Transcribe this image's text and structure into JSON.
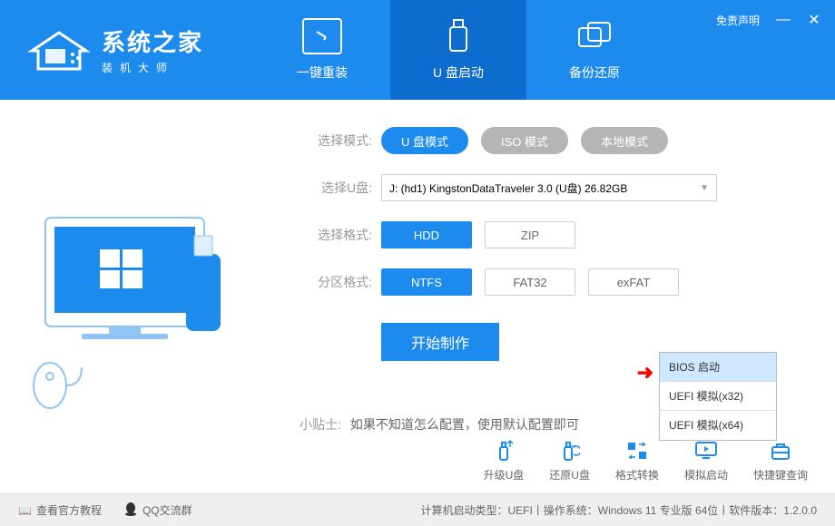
{
  "header": {
    "logo_title": "系统之家",
    "logo_subtitle": "装机大师",
    "disclaimer": "免责声明",
    "tabs": [
      {
        "label": "一键重装"
      },
      {
        "label": "U 盘启动"
      },
      {
        "label": "备份还原"
      }
    ]
  },
  "form": {
    "mode_label": "选择模式:",
    "modes": [
      {
        "label": "U 盘模式",
        "active": true
      },
      {
        "label": "ISO 模式",
        "active": false
      },
      {
        "label": "本地模式",
        "active": false
      }
    ],
    "usb_label": "选择U盘:",
    "usb_value": "J: (hd1) KingstonDataTraveler 3.0 (U盘) 26.82GB",
    "format_label": "选择格式:",
    "formats": [
      {
        "label": "HDD",
        "active": true
      },
      {
        "label": "ZIP",
        "active": false
      }
    ],
    "partition_label": "分区格式:",
    "partitions": [
      {
        "label": "NTFS",
        "active": true
      },
      {
        "label": "FAT32",
        "active": false
      },
      {
        "label": "exFAT",
        "active": false
      }
    ],
    "start_button": "开始制作",
    "tip_label": "小贴士:",
    "tip_text": "如果不知道怎么配置，使用默认配置即可"
  },
  "popup": {
    "items": [
      {
        "label": "BIOS 启动",
        "hover": true
      },
      {
        "label": "UEFI 模拟(x32)",
        "hover": false
      },
      {
        "label": "UEFI 模拟(x64)",
        "hover": false
      }
    ]
  },
  "tools": [
    {
      "label": "升级U盘"
    },
    {
      "label": "还原U盘"
    },
    {
      "label": "格式转换"
    },
    {
      "label": "模拟启动"
    },
    {
      "label": "快捷键查询"
    }
  ],
  "footer": {
    "tutorial": "查看官方教程",
    "qq_group": "QQ交流群",
    "status": "计算机启动类型：UEFI丨操作系统：Windows 11 专业版 64位丨软件版本：1.2.0.0"
  }
}
